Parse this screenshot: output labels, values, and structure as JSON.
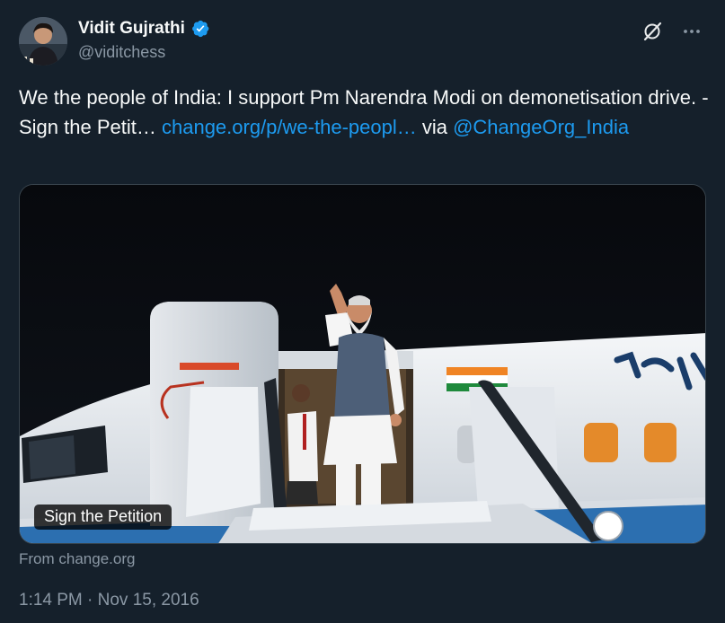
{
  "author": {
    "display_name": "Vidit Gujrathi",
    "handle": "@viditchess",
    "verified": true
  },
  "actions": {
    "grok_icon": "slashed-circle-icon",
    "more_icon": "more-dots-icon",
    "more_label": "···"
  },
  "tweet": {
    "text_plain": "We the people of India: I support Pm Narendra Modi on demonetisation drive. - Sign the Petit… ",
    "link_text": "change.org/p/we-the-peopl…",
    "via_text": " via ",
    "mention": "@ChangeOrg_India"
  },
  "card": {
    "badge": "Sign the Petition",
    "source": "From change.org"
  },
  "meta": {
    "timestamp": "1:14 PM · Nov 15, 2016"
  },
  "colors": {
    "background": "#15202b",
    "text": "#f7f9f9",
    "secondary_text": "#8b98a5",
    "link": "#1d9bf0",
    "verified": "#1d9bf0"
  }
}
